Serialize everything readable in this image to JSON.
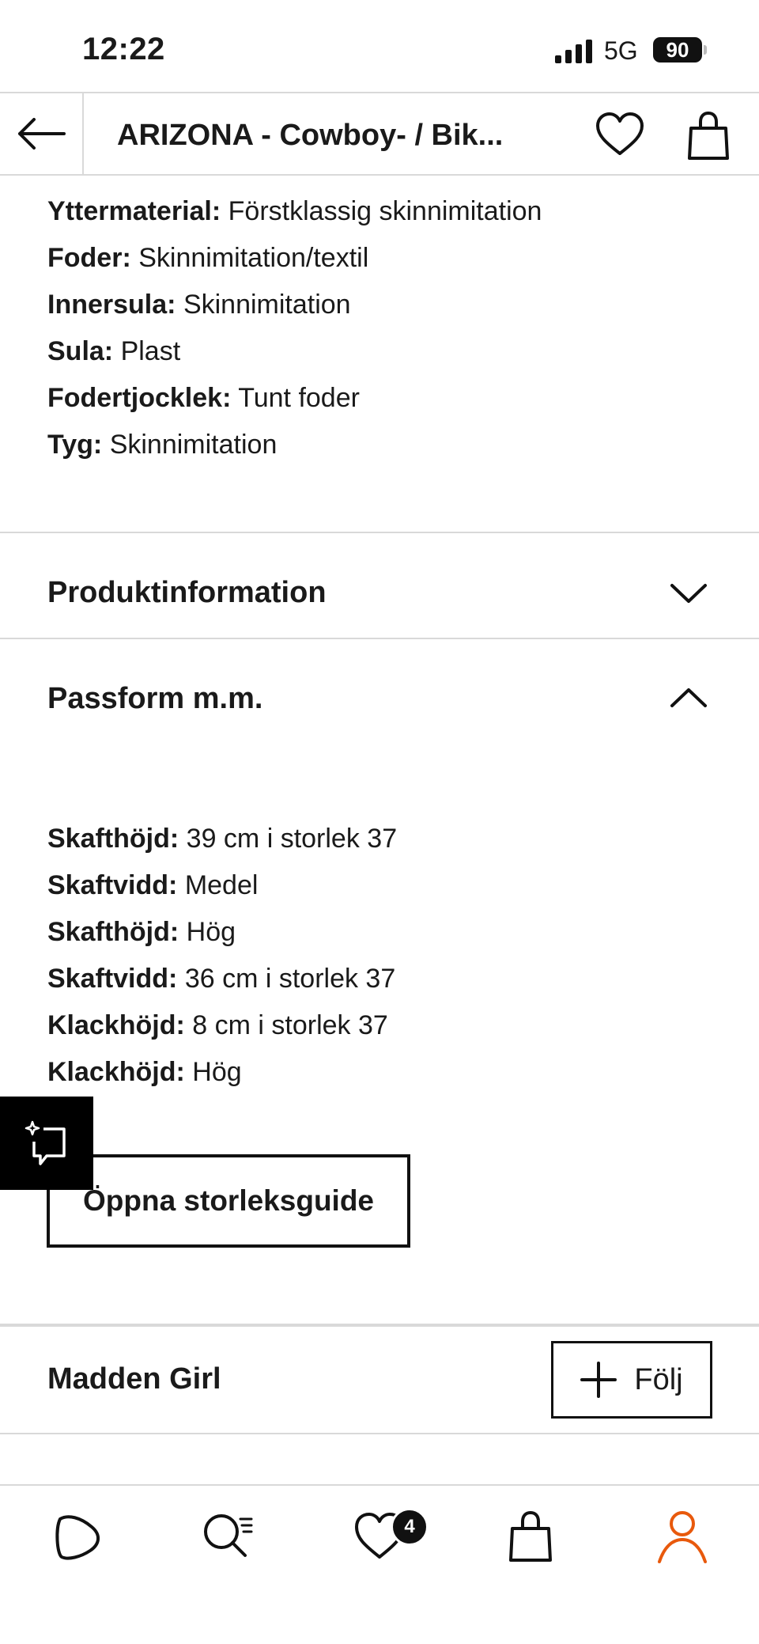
{
  "status_bar": {
    "time": "12:22",
    "network": "5G",
    "battery": "90"
  },
  "top_nav": {
    "title": "ARIZONA - Cowboy- / Bik..."
  },
  "material_specs": [
    {
      "label": "Yttermaterial:",
      "value": "Förstklassig skinnimitation"
    },
    {
      "label": "Foder:",
      "value": "Skinnimitation/textil"
    },
    {
      "label": "Innersula:",
      "value": "Skinnimitation"
    },
    {
      "label": "Sula:",
      "value": "Plast"
    },
    {
      "label": "Fodertjocklek:",
      "value": "Tunt foder"
    },
    {
      "label": "Tyg:",
      "value": "Skinnimitation"
    }
  ],
  "sections": {
    "product_info": "Produktinformation",
    "fit": "Passform m.m."
  },
  "fit_specs": [
    {
      "label": "Skafthöjd:",
      "value": "39 cm i storlek 37"
    },
    {
      "label": "Skaftvidd:",
      "value": "Medel"
    },
    {
      "label": "Skafthöjd:",
      "value": "Hög"
    },
    {
      "label": "Skaftvidd:",
      "value": "36 cm i storlek 37"
    },
    {
      "label": "Klackhöjd:",
      "value": "8 cm i storlek 37"
    },
    {
      "label": "Klackhöjd:",
      "value": "Hög"
    }
  ],
  "size_guide_button": "Öppna storleksguide",
  "brand": {
    "name": "Madden Girl",
    "follow_label": "Följ"
  },
  "tab_bar": {
    "wishlist_badge": "4",
    "active_color": "#e8590c"
  }
}
